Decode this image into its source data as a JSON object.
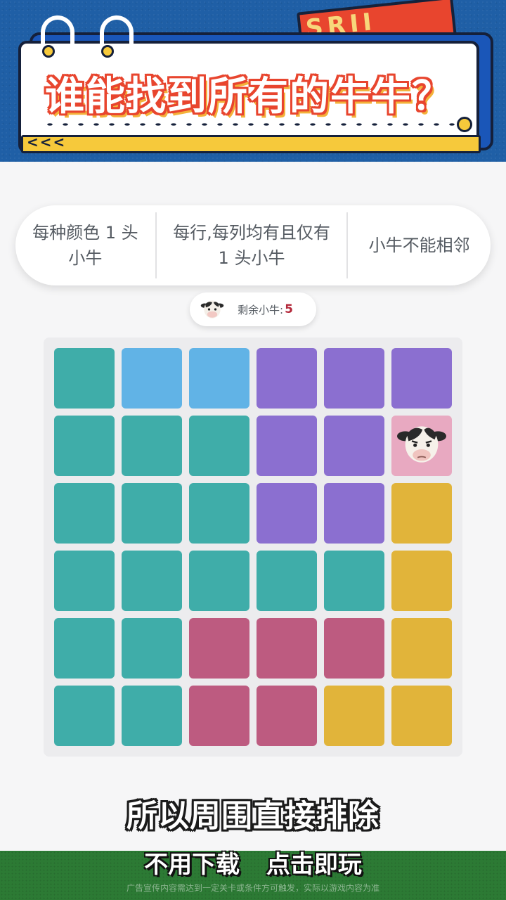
{
  "banner": {
    "title": "谁能找到所有的牛牛？",
    "burst_text": "SRII",
    "arrows": "<<<"
  },
  "rules": [
    "每种颜色 1 头小牛",
    "每行,每列均有且仅有 1 头小牛",
    "小牛不能相邻"
  ],
  "counter": {
    "label": "剩余小牛:",
    "value": "5",
    "icon": "cow-icon"
  },
  "colors": {
    "teal": "#3fada9",
    "blue": "#61b3e6",
    "purple": "#8b6fd0",
    "pink": "#e8a9c1",
    "gold": "#e1b43a",
    "rose": "#bd5b80"
  },
  "board": {
    "rows": 6,
    "cols": 6,
    "grid": [
      [
        "teal",
        "blue",
        "blue",
        "purple",
        "purple",
        "purple"
      ],
      [
        "teal",
        "teal",
        "teal",
        "purple",
        "purple",
        "pink"
      ],
      [
        "teal",
        "teal",
        "teal",
        "purple",
        "purple",
        "gold"
      ],
      [
        "teal",
        "teal",
        "teal",
        "teal",
        "teal",
        "gold"
      ],
      [
        "teal",
        "teal",
        "rose",
        "rose",
        "rose",
        "gold"
      ],
      [
        "teal",
        "teal",
        "rose",
        "rose",
        "gold",
        "gold"
      ]
    ],
    "cows": [
      [
        1,
        5
      ]
    ]
  },
  "caption": "所以周围直接排除",
  "footer": {
    "cta": "不用下载 点击即玩",
    "disclaimer": "广告宣传内容需达到一定关卡或条件方可触发，实际以游戏内容为准"
  }
}
